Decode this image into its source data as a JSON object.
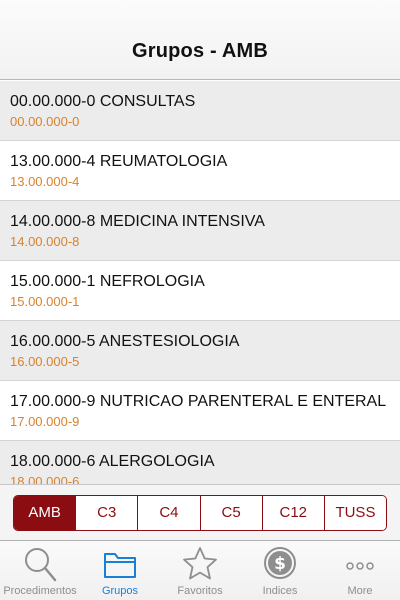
{
  "navbar": {
    "title": "Grupos - AMB"
  },
  "groups": [
    {
      "title": "00.00.000-0 CONSULTAS",
      "code": "00.00.000-0"
    },
    {
      "title": "13.00.000-4 REUMATOLOGIA",
      "code": "13.00.000-4"
    },
    {
      "title": "14.00.000-8 MEDICINA INTENSIVA",
      "code": "14.00.000-8"
    },
    {
      "title": "15.00.000-1 NEFROLOGIA",
      "code": "15.00.000-1"
    },
    {
      "title": "16.00.000-5 ANESTESIOLOGIA",
      "code": "16.00.000-5"
    },
    {
      "title": "17.00.000-9 NUTRICAO PARENTERAL E ENTERAL",
      "code": "17.00.000-9"
    },
    {
      "title": "18.00.000-6 ALERGOLOGIA",
      "code": "18.00.000-6"
    }
  ],
  "segments": [
    {
      "label": "AMB",
      "active": true
    },
    {
      "label": "C3",
      "active": false
    },
    {
      "label": "C4",
      "active": false
    },
    {
      "label": "C5",
      "active": false
    },
    {
      "label": "C12",
      "active": false
    },
    {
      "label": "TUSS",
      "active": false
    }
  ],
  "tabs": [
    {
      "label": "Procedimentos",
      "icon": "magnifier-icon",
      "active": false
    },
    {
      "label": "Grupos",
      "icon": "folder-icon",
      "active": true
    },
    {
      "label": "Favoritos",
      "icon": "star-icon",
      "active": false
    },
    {
      "label": "Indices",
      "icon": "dollar-coin-icon",
      "active": false
    },
    {
      "label": "More",
      "icon": "more-dots-icon",
      "active": false
    }
  ],
  "colors": {
    "accent": "#8b0d12",
    "code_text": "#d9822b",
    "tab_active": "#1a7fd6",
    "tab_inactive": "#8e8e8e"
  }
}
